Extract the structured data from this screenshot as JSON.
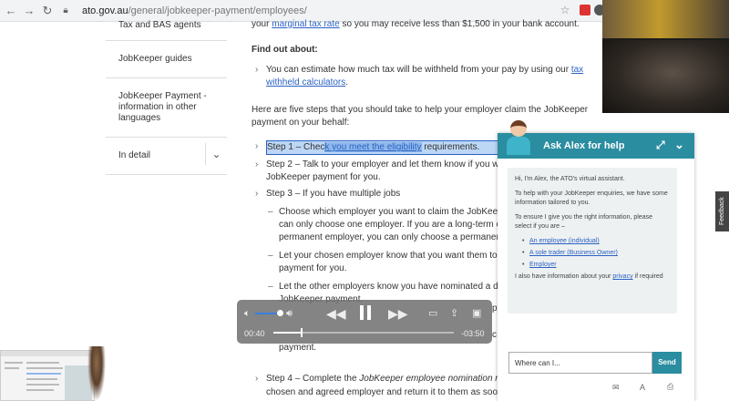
{
  "browser": {
    "url_host": "ato.gov.au",
    "url_path": "/general/jobkeeper-payment/employees/"
  },
  "sidebar": {
    "items": [
      {
        "label": "Tax and BAS agents"
      },
      {
        "label": "JobKeeper guides"
      },
      {
        "label": "JobKeeper Payment - information in other languages"
      },
      {
        "label": "In detail"
      }
    ]
  },
  "content": {
    "line0_pre": "your ",
    "line0_link": "marginal tax rate",
    "line0_post": " so you may receive less than $1,500 in your bank account.",
    "find_out": "Find out about:",
    "bullet1_pre": "You can estimate how much tax will be withheld from your pay by using our ",
    "bullet1_link": "tax withheld calculators",
    "bullet1_post": ".",
    "intro": "Here are five  steps that you should take to help your employer claim the JobKeeper payment on your behalf:",
    "step1_a": "Step  1 – Chec",
    "step1_b": "k you meet the eligibility",
    "step1_c": " requirements.",
    "step2": "Step  2 – Talk to your employer and let them know if you w",
    "step2_b": "JobKeeper payment for you.",
    "step3": "Step  3 – If you have multiple jobs",
    "sub1": "Choose which employer you want to claim the JobKeepe",
    "sub1_b": "can only choose one employer. If you are a long-term c",
    "sub1_c": "permanent employer, you can only choose a permaner",
    "sub2": "Let your chosen employer know that you want them to",
    "sub2_b": "payment for you.",
    "sub3": "Let the other employers know you have nominated a di",
    "sub3_b": "JobKeeper payment.",
    "frag_a": "py",
    "frag_b": "c",
    "payment": "payment.",
    "step4_a": "Step  4 – Complete the ",
    "step4_em": "JobKeeper employee nomination n",
    "step4_b": "chosen and agreed employer and return it to them as soon"
  },
  "player": {
    "elapsed": "00:40",
    "remaining": "-03:50",
    "progress": 0.15
  },
  "chat": {
    "title": "Ask Alex for help",
    "greeting": "Hi, I'm Alex, the ATO's virtual assistant.",
    "help": "To help with your JobKeeper enquiries, we have some information tailored to you.",
    "ensure": "To ensure I give you the right information, please select if you are –",
    "options": [
      {
        "label": "An employee (individual)"
      },
      {
        "label": "A sole trader (Business Owner)"
      },
      {
        "label": "Employer"
      }
    ],
    "privacy_pre": "I also have information about your ",
    "privacy_link": "privacy",
    "privacy_post": " if required",
    "input_placeholder": "Where can I...",
    "send_label": "Send",
    "accent": "#2a8da0"
  },
  "feedback": {
    "label": "Feedback"
  }
}
